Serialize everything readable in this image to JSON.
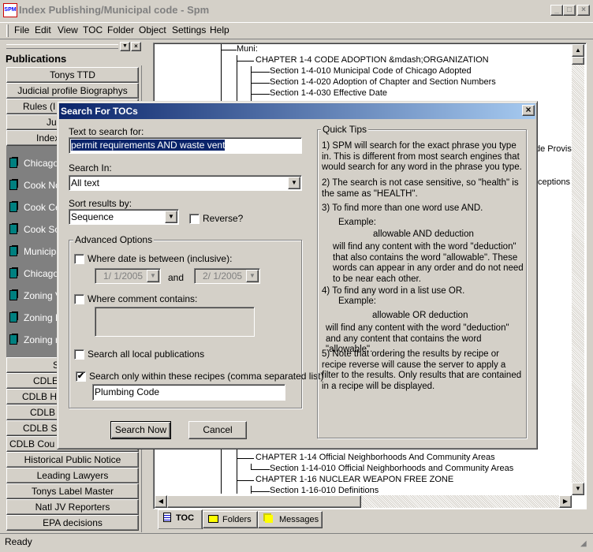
{
  "window": {
    "title": "Index Publishing/Municipal code - Spm",
    "logo": "SPM",
    "minimize": "_",
    "maximize": "□",
    "close": "×"
  },
  "menu": [
    "File",
    "Edit",
    "View",
    "TOC",
    "Folder",
    "Object",
    "Settings",
    "Help"
  ],
  "sidebar": {
    "heading": "Publications",
    "top_buttons": [
      "Tonys TTD",
      "Judicial profile Biographys",
      "Rules (I",
      "Ju",
      "Index"
    ],
    "items": [
      "Chicago",
      "Cook No",
      "Cook Ce",
      "Cook So",
      "Municipa",
      "Chicago",
      "Zoning V",
      "Zoning D",
      "Zoning m"
    ],
    "bottom_buttons": [
      "S",
      "CDLE",
      "CDLB H",
      "CDLB",
      "CDLB S",
      "CDLB Cou",
      "Historical Public Notice",
      "Leading Lawyers",
      "Tonys Label Master",
      "Natl JV Reporters",
      "EPA decisions"
    ]
  },
  "tree": {
    "nodes": [
      "Muni:",
      "CHAPTER 1-4 CODE ADOPTION &mdash;ORGANIZATION",
      "Section 1-4-010 Municipal Code of Chicago Adopted",
      "Section 1-4-020 Adoption of Chapter and Section Numbers",
      "Section 1-4-030 Effective Date"
    ],
    "fragments": [
      "de Provis",
      "ceptions"
    ],
    "bottom_nodes": [
      "CHAPTER 1-14 Official Neighborhoods And Community Areas",
      "Section 1-14-010 Official Neighborhoods and Community Areas",
      "CHAPTER 1-16 NUCLEAR WEAPON FREE ZONE",
      "Section 1-16-010 Definitions"
    ]
  },
  "tabs": [
    {
      "label": "TOC",
      "icon": "toc-icon",
      "active": true
    },
    {
      "label": "Folders",
      "icon": "folder-icon"
    },
    {
      "label": "Messages",
      "icon": "messages-icon"
    }
  ],
  "status": "Ready",
  "dialog": {
    "title": "Search For TOCs",
    "close": "×",
    "text_label": "Text to search for:",
    "text_value": "permit requirements AND waste vent",
    "search_in_label": "Search In:",
    "search_in_value": "All text",
    "sort_label": "Sort results by:",
    "sort_value": "Sequence",
    "reverse_label": "Reverse?",
    "reverse_checked": false,
    "advanced": {
      "title": "Advanced Options",
      "date_label": "Where date is between (inclusive):",
      "date_checked": false,
      "date_from": "1/ 1/2005",
      "and": "and",
      "date_to": "2/ 1/2005",
      "comment_label": "Where comment contains:",
      "comment_checked": false,
      "comment_value": "",
      "all_local_label": "Search all local publications",
      "all_local_checked": false,
      "recipes_label": "Search only within these recipes (comma separated list)",
      "recipes_checked": true,
      "recipes_value": "Plumbing Code"
    },
    "search_now": "Search Now",
    "cancel": "Cancel",
    "tips": {
      "title": "Quick Tips",
      "t1": "1) SPM will search for the exact phrase you type in. This is different from most search engines that would search for any word in the phrase you type.",
      "t2": "2) The search is not case sensitive, so \"health\" is the same as \"HEALTH\".",
      "t3": "3) To find more than one word use AND.",
      "example": "Example:",
      "ex3": "allowable AND deduction",
      "t3b": "will find any content with the word \"deduction\" that also contains the word \"allowable\". These words can appear in any order and do not need to be near each other.",
      "t4": "4) To find any word in a list use OR.",
      "ex4": "allowable OR deduction",
      "t4b": "will find any content with the word \"deduction\" and any content that contains the word \"allowable\".",
      "t5": "5) Note that ordering the results by recipe or recipe reverse will cause the server to apply a filter to the results.  Only results that are contained in a recipe will be displayed."
    }
  }
}
